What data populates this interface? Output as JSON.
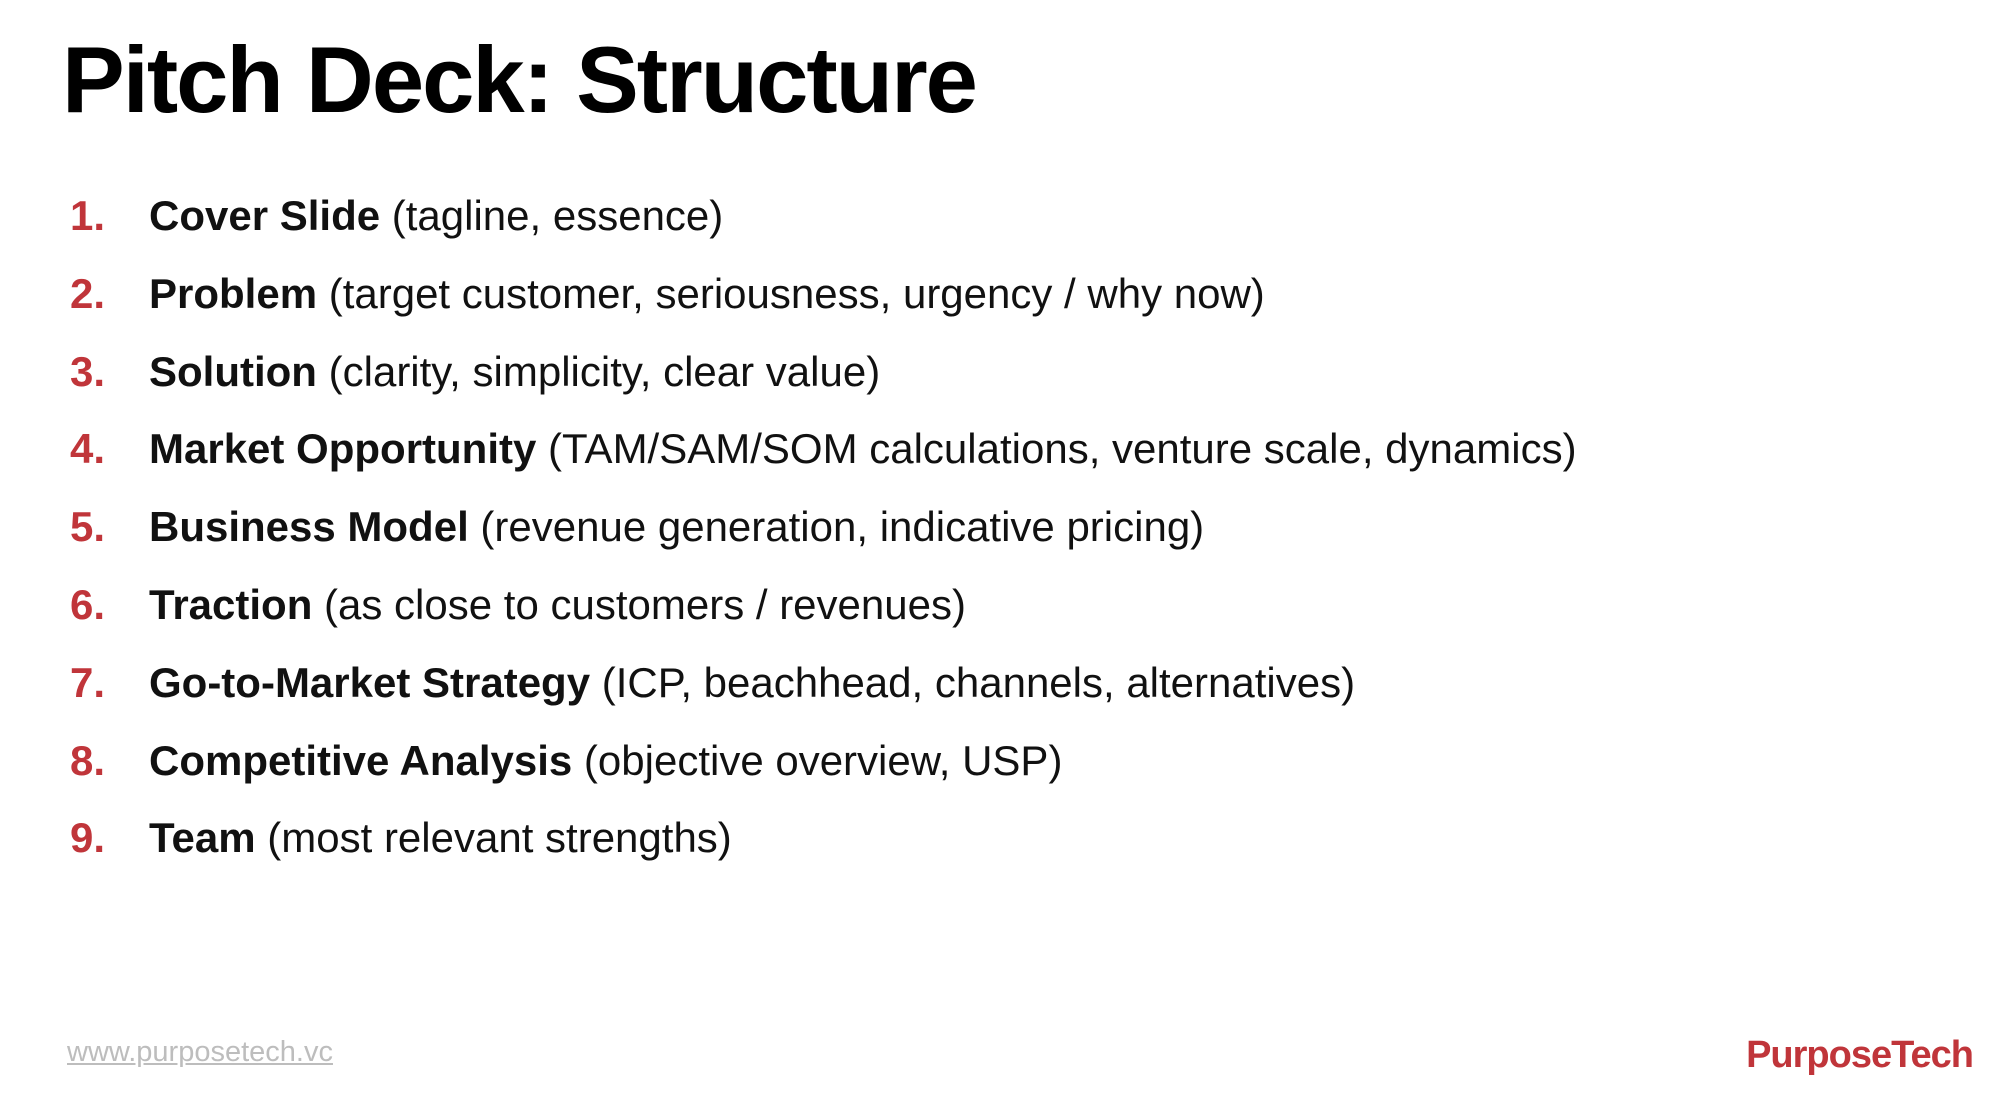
{
  "title": "Pitch Deck: Structure",
  "items": [
    {
      "num": "1.",
      "label": "Cover Slide",
      "detail": "(tagline, essence)"
    },
    {
      "num": "2.",
      "label": "Problem",
      "detail": "(target customer, seriousness, urgency / why now)"
    },
    {
      "num": "3.",
      "label": "Solution",
      "detail": "(clarity, simplicity, clear value)"
    },
    {
      "num": "4.",
      "label": "Market Opportunity",
      "detail": "(TAM/SAM/SOM calculations, venture scale, dynamics)"
    },
    {
      "num": "5.",
      "label": "Business Model",
      "detail": "(revenue generation, indicative pricing)"
    },
    {
      "num": "6.",
      "label": "Traction",
      "detail": "(as close to customers / revenues)"
    },
    {
      "num": "7.",
      "label": "Go-to-Market Strategy",
      "detail": "(ICP, beachhead, channels, alternatives)"
    },
    {
      "num": "8.",
      "label": "Competitive Analysis",
      "detail": "(objective overview, USP)"
    },
    {
      "num": "9.",
      "label": "Team",
      "detail": "(most relevant strengths)"
    }
  ],
  "footer": {
    "url": "www.purposetech.vc",
    "logo": "PurposeTech"
  },
  "colors": {
    "accent": "#c0353a",
    "text": "#111111",
    "url": "#bdbdbd"
  }
}
